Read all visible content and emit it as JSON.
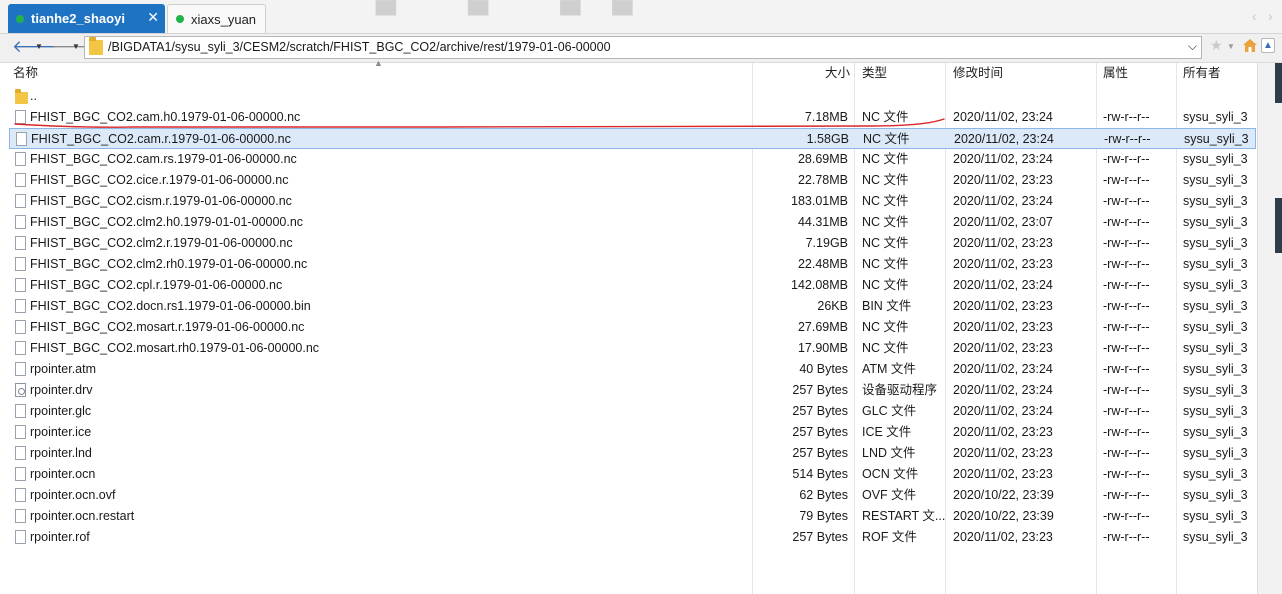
{
  "tabs": [
    {
      "label": "tianhe2_shaoyi",
      "active": true,
      "close": "✕"
    },
    {
      "label": "xiaxs_yuan",
      "active": false,
      "close": "✕"
    }
  ],
  "address": {
    "path": "/BIGDATA1/sysu_syli_3/CESM2/scratch/FHIST_BGC_CO2/archive/rest/1979-01-06-00000"
  },
  "columns": {
    "name": "名称",
    "size": "大小",
    "type": "类型",
    "modified": "修改时间",
    "attributes": "属性",
    "owner": "所有者"
  },
  "parent_entry": "..",
  "files": [
    {
      "name": "FHIST_BGC_CO2.cam.h0.1979-01-06-00000.nc",
      "size": "7.18MB",
      "type": "NC 文件",
      "modified": "2020/11/02, 23:24",
      "perm": "-rw-r--r--",
      "owner": "sysu_syli_3",
      "icon": "file-icon"
    },
    {
      "name": "FHIST_BGC_CO2.cam.r.1979-01-06-00000.nc",
      "size": "1.58GB",
      "type": "NC 文件",
      "modified": "2020/11/02, 23:24",
      "perm": "-rw-r--r--",
      "owner": "sysu_syli_3",
      "icon": "file-icon",
      "selected": true
    },
    {
      "name": "FHIST_BGC_CO2.cam.rs.1979-01-06-00000.nc",
      "size": "28.69MB",
      "type": "NC 文件",
      "modified": "2020/11/02, 23:24",
      "perm": "-rw-r--r--",
      "owner": "sysu_syli_3",
      "icon": "file-icon"
    },
    {
      "name": "FHIST_BGC_CO2.cice.r.1979-01-06-00000.nc",
      "size": "22.78MB",
      "type": "NC 文件",
      "modified": "2020/11/02, 23:23",
      "perm": "-rw-r--r--",
      "owner": "sysu_syli_3",
      "icon": "file-icon"
    },
    {
      "name": "FHIST_BGC_CO2.cism.r.1979-01-06-00000.nc",
      "size": "183.01MB",
      "type": "NC 文件",
      "modified": "2020/11/02, 23:24",
      "perm": "-rw-r--r--",
      "owner": "sysu_syli_3",
      "icon": "file-icon"
    },
    {
      "name": "FHIST_BGC_CO2.clm2.h0.1979-01-01-00000.nc",
      "size": "44.31MB",
      "type": "NC 文件",
      "modified": "2020/11/02, 23:07",
      "perm": "-rw-r--r--",
      "owner": "sysu_syli_3",
      "icon": "file-icon"
    },
    {
      "name": "FHIST_BGC_CO2.clm2.r.1979-01-06-00000.nc",
      "size": "7.19GB",
      "type": "NC 文件",
      "modified": "2020/11/02, 23:23",
      "perm": "-rw-r--r--",
      "owner": "sysu_syli_3",
      "icon": "file-icon"
    },
    {
      "name": "FHIST_BGC_CO2.clm2.rh0.1979-01-06-00000.nc",
      "size": "22.48MB",
      "type": "NC 文件",
      "modified": "2020/11/02, 23:23",
      "perm": "-rw-r--r--",
      "owner": "sysu_syli_3",
      "icon": "file-icon"
    },
    {
      "name": "FHIST_BGC_CO2.cpl.r.1979-01-06-00000.nc",
      "size": "142.08MB",
      "type": "NC 文件",
      "modified": "2020/11/02, 23:24",
      "perm": "-rw-r--r--",
      "owner": "sysu_syli_3",
      "icon": "file-icon"
    },
    {
      "name": "FHIST_BGC_CO2.docn.rs1.1979-01-06-00000.bin",
      "size": "26KB",
      "type": "BIN 文件",
      "modified": "2020/11/02, 23:23",
      "perm": "-rw-r--r--",
      "owner": "sysu_syli_3",
      "icon": "file-icon"
    },
    {
      "name": "FHIST_BGC_CO2.mosart.r.1979-01-06-00000.nc",
      "size": "27.69MB",
      "type": "NC 文件",
      "modified": "2020/11/02, 23:23",
      "perm": "-rw-r--r--",
      "owner": "sysu_syli_3",
      "icon": "file-icon"
    },
    {
      "name": "FHIST_BGC_CO2.mosart.rh0.1979-01-06-00000.nc",
      "size": "17.90MB",
      "type": "NC 文件",
      "modified": "2020/11/02, 23:23",
      "perm": "-rw-r--r--",
      "owner": "sysu_syli_3",
      "icon": "file-icon"
    },
    {
      "name": "rpointer.atm",
      "size": "40 Bytes",
      "type": "ATM 文件",
      "modified": "2020/11/02, 23:24",
      "perm": "-rw-r--r--",
      "owner": "sysu_syli_3",
      "icon": "file-icon"
    },
    {
      "name": "rpointer.drv",
      "size": "257 Bytes",
      "type": "设备驱动程序",
      "modified": "2020/11/02, 23:24",
      "perm": "-rw-r--r--",
      "owner": "sysu_syli_3",
      "icon": "driver-file-icon"
    },
    {
      "name": "rpointer.glc",
      "size": "257 Bytes",
      "type": "GLC 文件",
      "modified": "2020/11/02, 23:24",
      "perm": "-rw-r--r--",
      "owner": "sysu_syli_3",
      "icon": "file-icon"
    },
    {
      "name": "rpointer.ice",
      "size": "257 Bytes",
      "type": "ICE 文件",
      "modified": "2020/11/02, 23:23",
      "perm": "-rw-r--r--",
      "owner": "sysu_syli_3",
      "icon": "file-icon"
    },
    {
      "name": "rpointer.lnd",
      "size": "257 Bytes",
      "type": "LND 文件",
      "modified": "2020/11/02, 23:23",
      "perm": "-rw-r--r--",
      "owner": "sysu_syli_3",
      "icon": "file-icon"
    },
    {
      "name": "rpointer.ocn",
      "size": "514 Bytes",
      "type": "OCN 文件",
      "modified": "2020/11/02, 23:23",
      "perm": "-rw-r--r--",
      "owner": "sysu_syli_3",
      "icon": "file-icon"
    },
    {
      "name": "rpointer.ocn.ovf",
      "size": "62 Bytes",
      "type": "OVF 文件",
      "modified": "2020/10/22, 23:39",
      "perm": "-rw-r--r--",
      "owner": "sysu_syli_3",
      "icon": "file-icon"
    },
    {
      "name": "rpointer.ocn.restart",
      "size": "79 Bytes",
      "type": "RESTART 文...",
      "modified": "2020/10/22, 23:39",
      "perm": "-rw-r--r--",
      "owner": "sysu_syli_3",
      "icon": "file-icon"
    },
    {
      "name": "rpointer.rof",
      "size": "257 Bytes",
      "type": "ROF 文件",
      "modified": "2020/11/02, 23:23",
      "perm": "-rw-r--r--",
      "owner": "sysu_syli_3",
      "icon": "file-icon"
    }
  ],
  "colors": {
    "tab_active": "#1e74c2",
    "tab_dot": "#21b34a",
    "selection": "#dbe9f8",
    "selection_border": "#8ab6e8",
    "annotation_stroke": "#d8262a"
  }
}
